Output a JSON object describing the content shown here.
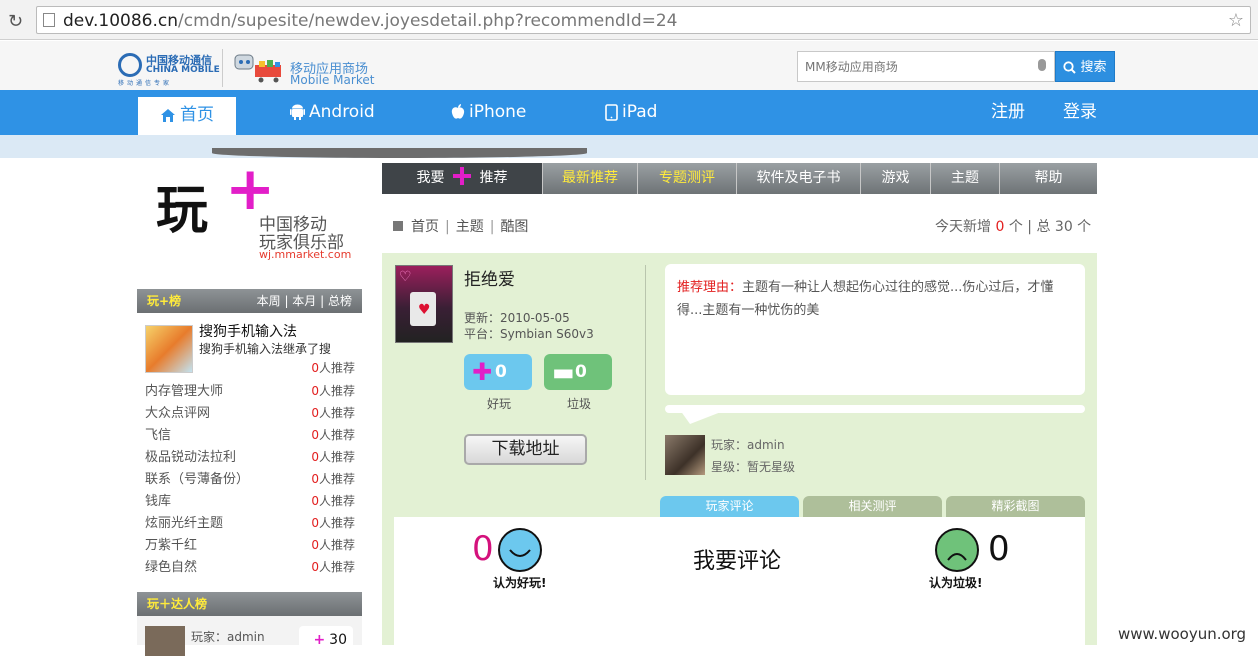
{
  "browser": {
    "url_host": "dev.10086.cn",
    "url_path": "/cmdn/supesite/newdev.joyesdetail.php?recommendId=24"
  },
  "header": {
    "cm_logo_cn": "中国移动通信",
    "cm_logo_en": "CHINA MOBILE",
    "cm_logo_slogan": "移动通信专家",
    "mm_logo_cn": "移动应用商场",
    "mm_logo_en": "Mobile Market",
    "search_placeholder": "MM移动应用商场",
    "search_button": "搜索"
  },
  "nav": {
    "home": "首页",
    "android": "Android",
    "iphone": "iPhone",
    "ipad": "iPad",
    "register": "注册",
    "login": "登录"
  },
  "play_logo": {
    "big": "玩",
    "plus": "+",
    "club_line1": "中国移动",
    "club_line2": "玩家俱乐部",
    "url": "wj.mmarket.com"
  },
  "rank": {
    "title": "玩+榜",
    "tabs": [
      "本周",
      "本月",
      "总榜"
    ],
    "first": {
      "name": "搜狗手机输入法",
      "desc": "搜狗手机输入法继承了搜",
      "count": "0",
      "suffix": "人推荐"
    },
    "items": [
      {
        "name": "内存管理大师",
        "count": "0",
        "suffix": "人推荐"
      },
      {
        "name": "大众点评网",
        "count": "0",
        "suffix": "人推荐"
      },
      {
        "name": "飞信",
        "count": "0",
        "suffix": "人推荐"
      },
      {
        "name": "极品锐动法拉利",
        "count": "0",
        "suffix": "人推荐"
      },
      {
        "name": "联系（号薄备份）",
        "count": "0",
        "suffix": "人推荐"
      },
      {
        "name": "钱库",
        "count": "0",
        "suffix": "人推荐"
      },
      {
        "name": "炫丽光纤主题",
        "count": "0",
        "suffix": "人推荐"
      },
      {
        "name": "万紫千红",
        "count": "0",
        "suffix": "人推荐"
      },
      {
        "name": "绿色自然",
        "count": "0",
        "suffix": "人推荐"
      }
    ]
  },
  "expert": {
    "title": "玩＋达人榜",
    "player": "玩家：admin",
    "count": "30"
  },
  "tabs": {
    "recommend_a": "我要",
    "recommend_b": "推荐",
    "latest": "最新推荐",
    "special": "专题测评",
    "software": "软件及电子书",
    "games": "游戏",
    "themes": "主题",
    "help": "帮助"
  },
  "crumb": {
    "home": "首页",
    "theme": "主题",
    "cool": "酷图",
    "stats_prefix": "今天新增 ",
    "today_count": "0",
    "stats_mid": " 个 | 总 ",
    "total": "30",
    "stats_suffix": " 个"
  },
  "app": {
    "name": "拒绝爱",
    "updated": "更新：2010-05-05",
    "platform": "平台：Symbian S60v3",
    "good_count": "0",
    "bad_count": "0",
    "good_label": "好玩",
    "bad_label": "垃圾",
    "download": "下载地址"
  },
  "reason": {
    "label": "推荐理由：",
    "text": "主题有一种让人想起伤心过往的感觉...伤心过后，才懂得...主题有一种忧伤的美"
  },
  "player": {
    "name": "玩家：admin",
    "level": "星级：暂无星级"
  },
  "comment_tabs": [
    "玩家评论",
    "相关测评",
    "精彩截图"
  ],
  "comments": {
    "good_count": "0",
    "good_label": "认为好玩!",
    "bad_count": "0",
    "bad_label": "认为垃圾!",
    "cta": "我要评论"
  },
  "watermark": "www.wooyun.org",
  "colors": {
    "brand_blue": "#2f92e5",
    "accent_magenta": "#e21ec8",
    "panel_green": "#e3f1d4"
  }
}
